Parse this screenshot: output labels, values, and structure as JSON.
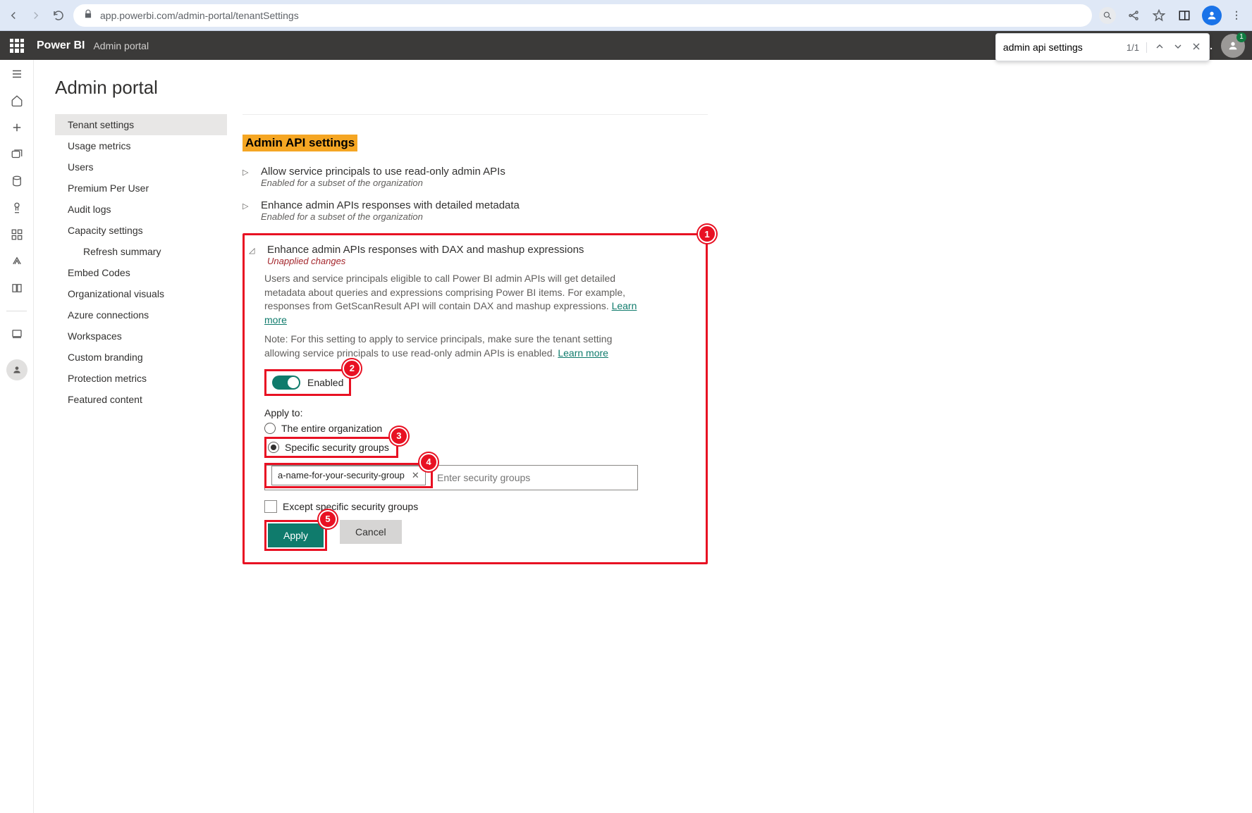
{
  "browser": {
    "url": "app.powerbi.com/admin-portal/tenantSettings"
  },
  "find": {
    "query": "admin api settings",
    "count": "1/1"
  },
  "topbar": {
    "brand": "Power BI",
    "section": "Admin portal",
    "badge": "1",
    "more": "..."
  },
  "page": {
    "title": "Admin portal"
  },
  "nav": {
    "items": [
      {
        "label": "Tenant settings",
        "active": true
      },
      {
        "label": "Usage metrics"
      },
      {
        "label": "Users"
      },
      {
        "label": "Premium Per User"
      },
      {
        "label": "Audit logs"
      },
      {
        "label": "Capacity settings"
      },
      {
        "label": "Refresh summary",
        "indent": true
      },
      {
        "label": "Embed Codes"
      },
      {
        "label": "Organizational visuals"
      },
      {
        "label": "Azure connections"
      },
      {
        "label": "Workspaces"
      },
      {
        "label": "Custom branding"
      },
      {
        "label": "Protection metrics"
      },
      {
        "label": "Featured content"
      }
    ]
  },
  "section": {
    "heading": "Admin API settings"
  },
  "settings": {
    "s1": {
      "title": "Allow service principals to use read-only admin APIs",
      "sub": "Enabled for a subset of the organization"
    },
    "s2": {
      "title": "Enhance admin APIs responses with detailed metadata",
      "sub": "Enabled for a subset of the organization"
    },
    "s3": {
      "title": "Enhance admin APIs responses with DAX and mashup expressions",
      "sub": "Unapplied changes",
      "desc1": "Users and service principals eligible to call Power BI admin APIs will get detailed metadata about queries and expressions comprising Power BI items. For example, responses from GetScanResult API will contain DAX and mashup expressions. ",
      "learn": "Learn more",
      "desc2": "Note: For this setting to apply to service principals, make sure the tenant setting allowing service principals to use read-only admin APIs is enabled. ",
      "toggle_label": "Enabled",
      "apply_label": "Apply to:",
      "radio_all": "The entire organization",
      "radio_groups": "Specific security groups",
      "tag": "a-name-for-your-security-group",
      "tag_placeholder": "Enter security groups",
      "except_label": "Except specific security groups",
      "apply_btn": "Apply",
      "cancel_btn": "Cancel"
    }
  },
  "callouts": {
    "c1": "1",
    "c2": "2",
    "c3": "3",
    "c4": "4",
    "c5": "5"
  }
}
